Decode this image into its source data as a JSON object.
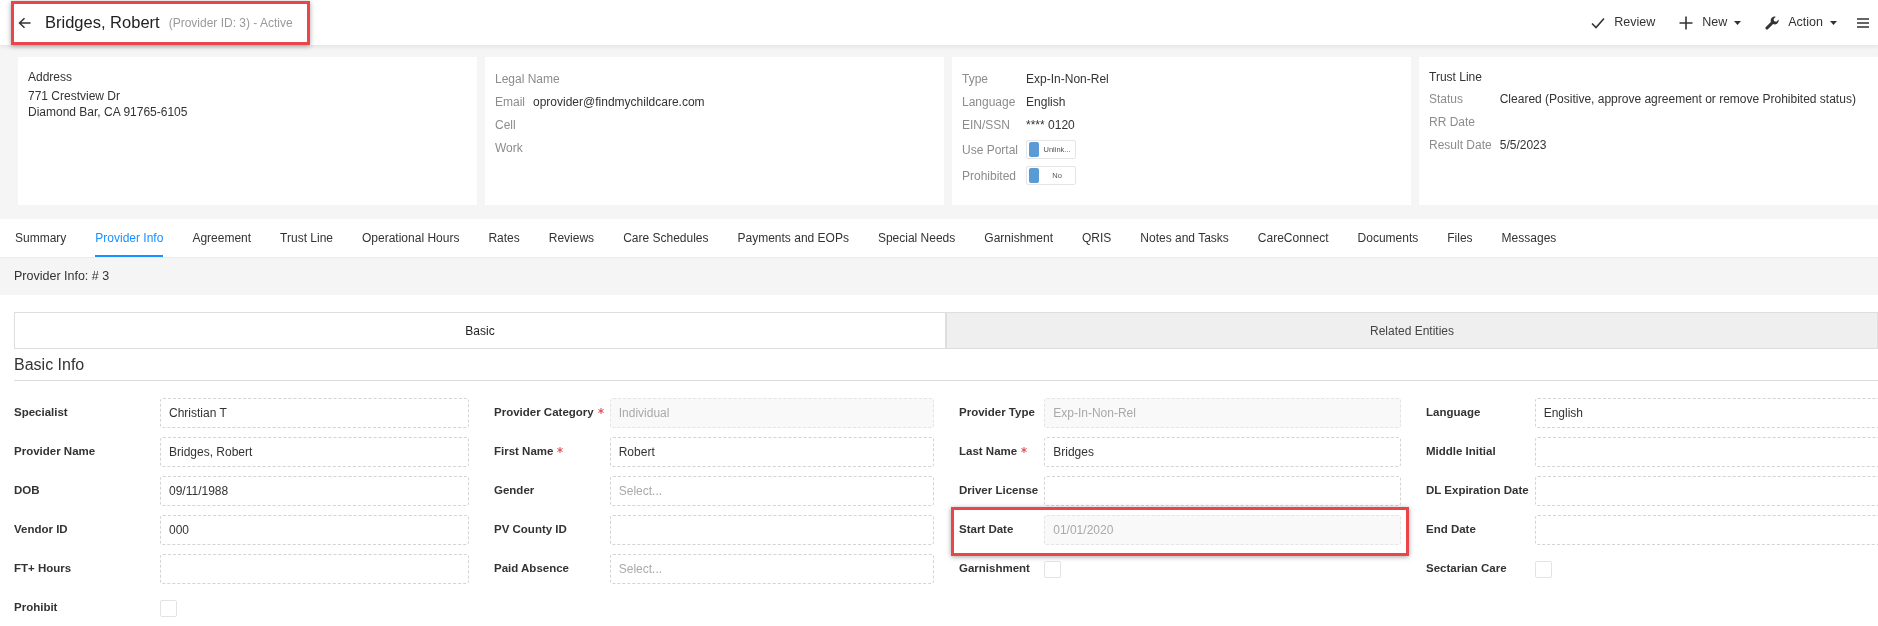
{
  "header": {
    "title": "Bridges, Robert",
    "subtitle": "(Provider ID: 3) - Active",
    "highlighted": true
  },
  "actions": [
    {
      "label": "Review",
      "dropdown": false
    },
    {
      "label": "New",
      "dropdown": true
    },
    {
      "label": "Action",
      "dropdown": true
    }
  ],
  "info_cards": [
    {
      "title": "Address",
      "lines": [
        "771 Crestview Dr",
        "Diamond Bar, CA 91765-6105"
      ]
    },
    {
      "rows": [
        {
          "label": "Legal Name",
          "kind": "text"
        },
        {
          "label": "Email",
          "kind": "text",
          "value": "oprovider@findmychildcare.com"
        },
        {
          "label": "Cell",
          "kind": "text"
        },
        {
          "label": "Work",
          "kind": "text"
        }
      ]
    },
    {
      "rows": [
        {
          "label": "Type",
          "kind": "text",
          "value": "Exp-In-Non-Rel"
        },
        {
          "label": "Language",
          "kind": "text",
          "value": "English"
        },
        {
          "label": "EIN/SSN",
          "kind": "text",
          "value": "**** 0120"
        },
        {
          "label": "Use Portal",
          "kind": "toggle",
          "on": false,
          "value": "Unlink..."
        },
        {
          "label": "Prohibited",
          "kind": "toggle",
          "on": false,
          "value": "No"
        }
      ]
    },
    {
      "title": "Trust Line",
      "rows": [
        {
          "label": "Status",
          "kind": "text",
          "value": "Cleared (Positive, approve agreement or remove Prohibited status)"
        },
        {
          "label": "RR Date",
          "kind": "text"
        },
        {
          "label": "Result Date",
          "kind": "text",
          "value": "5/5/2023"
        }
      ]
    }
  ],
  "tabs": [
    {
      "label": "Summary",
      "selected": false
    },
    {
      "label": "Provider Info",
      "selected": true
    },
    {
      "label": "Agreement",
      "selected": false
    },
    {
      "label": "Trust Line",
      "selected": false
    },
    {
      "label": "Operational Hours",
      "selected": false
    },
    {
      "label": "Rates",
      "selected": false
    },
    {
      "label": "Reviews",
      "selected": false
    },
    {
      "label": "Care Schedules",
      "selected": false
    },
    {
      "label": "Payments and EOPs",
      "selected": false
    },
    {
      "label": "Special Needs",
      "selected": false
    },
    {
      "label": "Garnishment",
      "selected": false
    },
    {
      "label": "QRIS",
      "selected": false
    },
    {
      "label": "Notes and Tasks",
      "selected": false
    },
    {
      "label": "CareConnect",
      "selected": false
    },
    {
      "label": "Documents",
      "selected": false
    },
    {
      "label": "Files",
      "selected": false
    },
    {
      "label": "Messages",
      "selected": false
    }
  ],
  "breadcrumb": "Provider Info: # 3",
  "section_tabs": [
    {
      "label": "Basic",
      "selected": true
    },
    {
      "label": "Related Entities",
      "selected": false
    }
  ],
  "basic_info": {
    "title": "Basic Info",
    "columns": [
      {
        "fields": [
          {
            "label": "Specialist",
            "kind": "text",
            "value": "Christian T",
            "required": false,
            "disabled": false,
            "highlighted": false
          },
          {
            "label": "Provider Name",
            "kind": "text",
            "value": "Bridges, Robert",
            "required": false,
            "disabled": false,
            "highlighted": false
          },
          {
            "label": "DOB",
            "kind": "text",
            "value": "09/11/1988",
            "required": false,
            "disabled": false,
            "highlighted": false
          },
          {
            "label": "Vendor ID",
            "kind": "text",
            "value": "000",
            "required": false,
            "disabled": false,
            "highlighted": false
          },
          {
            "label": "FT+ Hours",
            "kind": "text",
            "required": false,
            "disabled": false,
            "highlighted": false
          },
          {
            "label": "Prohibit",
            "kind": "checkbox",
            "checked": false,
            "required": false,
            "disabled": false,
            "highlighted": false
          }
        ]
      },
      {
        "fields": [
          {
            "label": "Provider Category",
            "kind": "text",
            "value": "Individual",
            "required": true,
            "disabled": true,
            "highlighted": false
          },
          {
            "label": "First Name",
            "kind": "text",
            "value": "Robert",
            "required": true,
            "disabled": false,
            "highlighted": false
          },
          {
            "label": "Gender",
            "kind": "text",
            "placeholder": "Select...",
            "required": false,
            "disabled": false,
            "highlighted": false
          },
          {
            "label": "PV County ID",
            "kind": "text",
            "required": false,
            "disabled": false,
            "highlighted": false
          },
          {
            "label": "Paid Absence",
            "kind": "text",
            "placeholder": "Select...",
            "required": false,
            "disabled": false,
            "highlighted": false
          }
        ]
      },
      {
        "fields": [
          {
            "label": "Provider Type",
            "kind": "text",
            "value": "Exp-In-Non-Rel",
            "required": false,
            "disabled": true,
            "highlighted": false
          },
          {
            "label": "Last Name",
            "kind": "text",
            "value": "Bridges",
            "required": true,
            "disabled": false,
            "highlighted": false
          },
          {
            "label": "Driver License",
            "kind": "text",
            "required": false,
            "disabled": false,
            "highlighted": false
          },
          {
            "label": "Start Date",
            "kind": "text",
            "value": "01/01/2020",
            "required": false,
            "disabled": true,
            "highlighted": true
          },
          {
            "label": "Garnishment",
            "kind": "checkbox",
            "checked": false,
            "required": false,
            "disabled": false,
            "highlighted": false
          }
        ]
      },
      {
        "fields": [
          {
            "label": "Language",
            "kind": "text",
            "value": "English",
            "required": false,
            "disabled": false,
            "highlighted": false
          },
          {
            "label": "Middle Initial",
            "kind": "text",
            "required": false,
            "disabled": false,
            "highlighted": false
          },
          {
            "label": "DL Expiration Date",
            "kind": "text",
            "required": false,
            "disabled": false,
            "highlighted": false
          },
          {
            "label": "End Date",
            "kind": "text",
            "required": false,
            "disabled": false,
            "highlighted": false
          },
          {
            "label": "Sectarian Care",
            "kind": "checkbox",
            "checked": false,
            "required": false,
            "disabled": false,
            "highlighted": false
          }
        ]
      }
    ]
  }
}
